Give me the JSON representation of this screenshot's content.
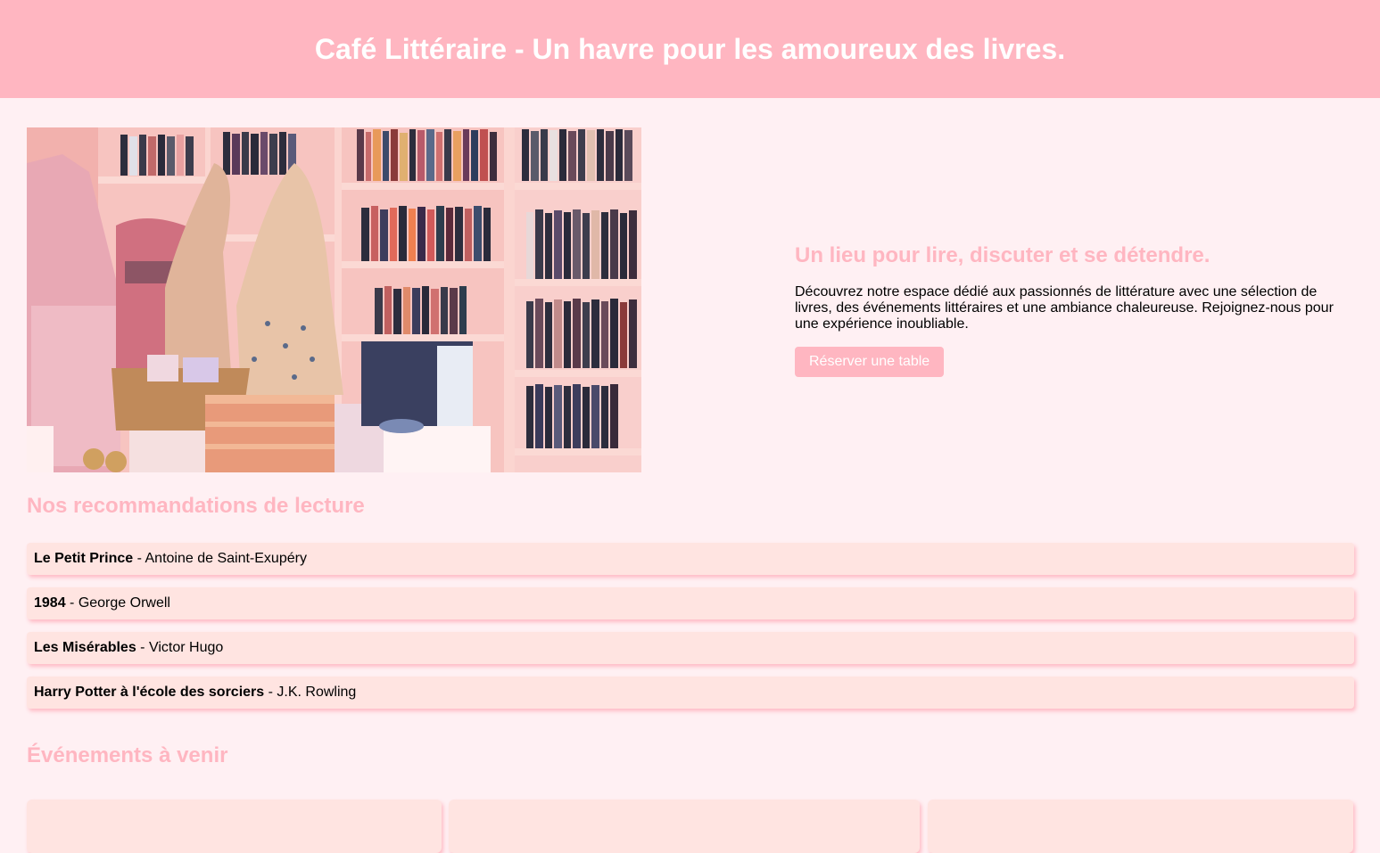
{
  "header": {
    "title": "Café Littéraire - Un havre pour les amoureux des livres."
  },
  "hero": {
    "image_alt": "Intérieur de la librairie",
    "heading": "Un lieu pour lire, discuter et se détendre.",
    "description": "Découvrez notre espace dédié aux passionnés de littérature avec une sélection de livres, des événements littéraires et une ambiance chaleureuse. Rejoignez-nous pour une expérience inoubliable.",
    "button_label": "Réserver une table"
  },
  "recommendations": {
    "title": "Nos recommandations de lecture",
    "items": [
      {
        "book": "Le Petit Prince",
        "author": " - Antoine de Saint-Exupéry"
      },
      {
        "book": "1984",
        "author": " - George Orwell"
      },
      {
        "book": "Les Misérables",
        "author": " - Victor Hugo"
      },
      {
        "book": "Harry Potter à l'école des sorciers",
        "author": " - J.K. Rowling"
      }
    ]
  },
  "events": {
    "title": "Événements à venir"
  },
  "colors": {
    "accent": "#ffb6c1",
    "background": "#fff0f3",
    "card": "#ffe4e1"
  }
}
